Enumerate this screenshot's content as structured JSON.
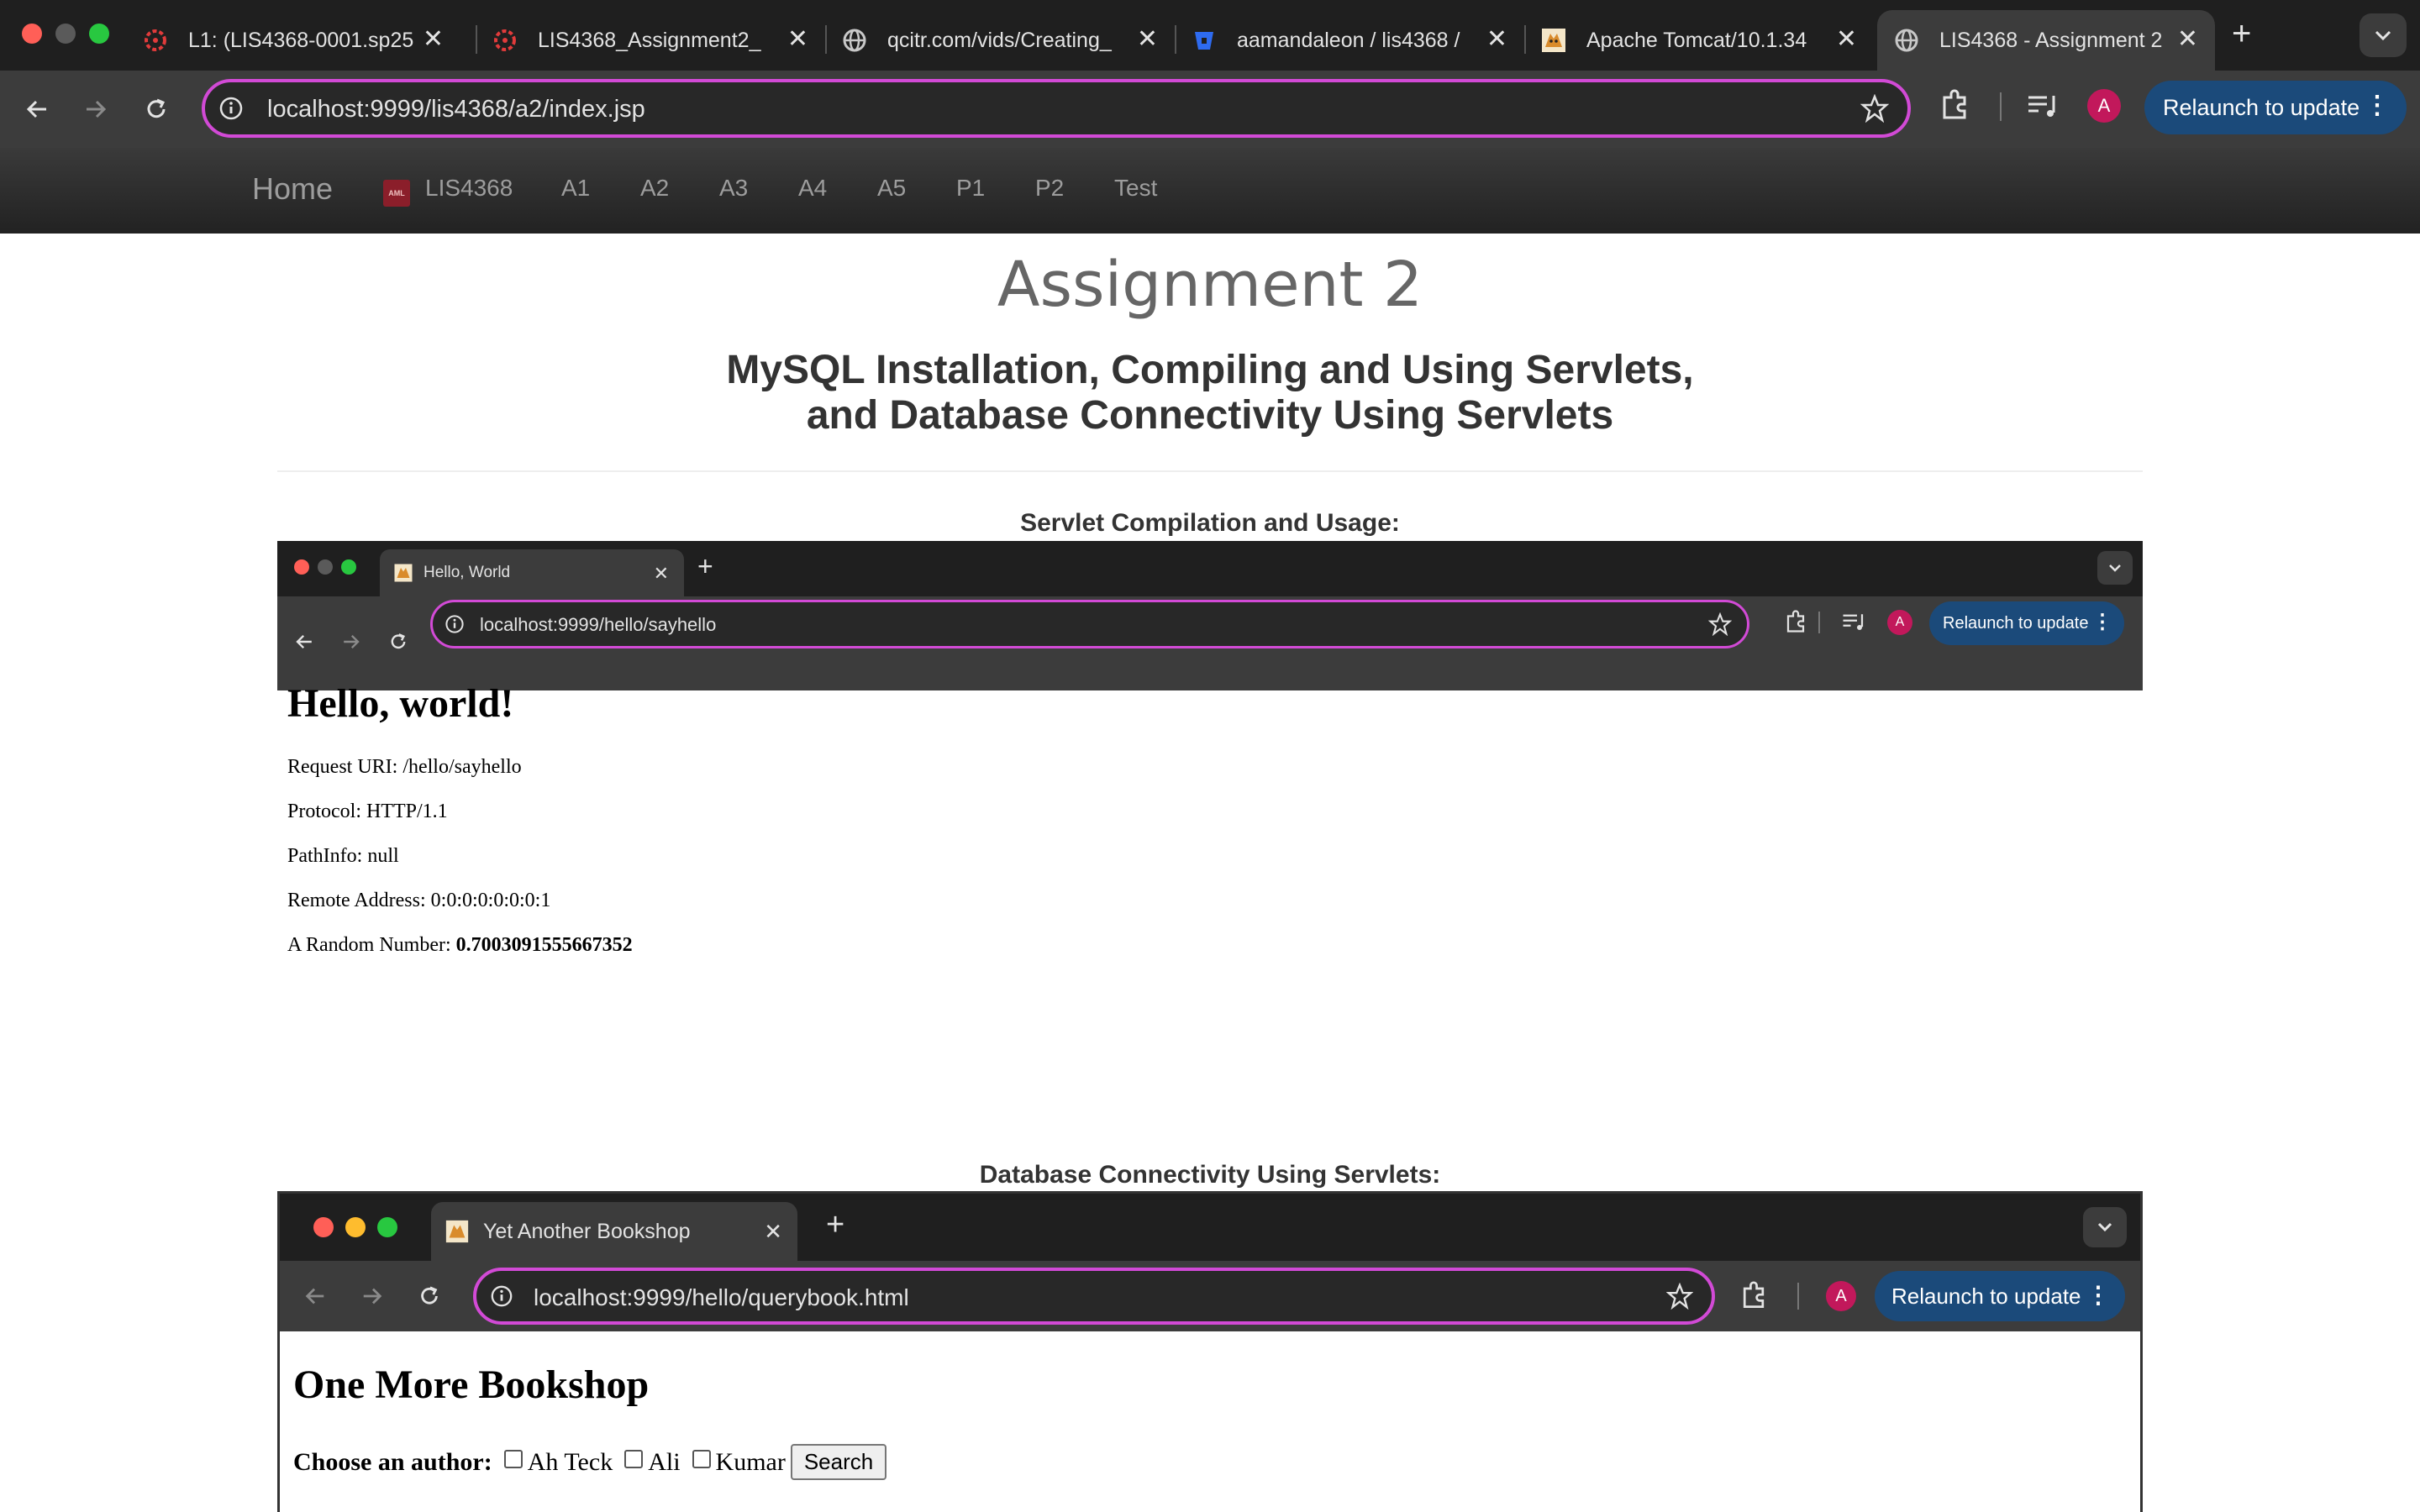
{
  "browser": {
    "tabs": [
      {
        "label": "L1: (LIS4368-0001.sp25",
        "icon": "canvas-icon"
      },
      {
        "label": "LIS4368_Assignment2_",
        "icon": "canvas-icon"
      },
      {
        "label": "qcitr.com/vids/Creating_",
        "icon": "globe-icon"
      },
      {
        "label": "aamandaleon / lis4368 /",
        "icon": "bitbucket-icon"
      },
      {
        "label": "Apache Tomcat/10.1.34",
        "icon": "tomcat-icon"
      },
      {
        "label": "LIS4368 - Assignment 2",
        "icon": "globe-icon"
      }
    ],
    "url": "localhost:9999/lis4368/a2/index.jsp",
    "relaunch_label": "Relaunch to update",
    "avatar_letter": "A"
  },
  "nav": {
    "home": "Home",
    "course": "LIS4368",
    "course_logo": "AML",
    "items": [
      "A1",
      "A2",
      "A3",
      "A4",
      "A5",
      "P1",
      "P2",
      "Test"
    ]
  },
  "page": {
    "title": "Assignment 2",
    "subtitle_line1": "MySQL Installation, Compiling and Using Servlets,",
    "subtitle_line2": "and Database Connectivity Using Servlets",
    "section1_heading": "Servlet Compilation and Usage:",
    "section2_heading": "Database Connectivity Using Servlets:"
  },
  "shot1": {
    "tab_label": "Hello, World",
    "url": "localhost:9999/hello/sayhello",
    "relaunch_label": "Relaunch to update",
    "avatar_letter": "A",
    "heading": "Hello, world!",
    "request_uri": "Request URI: /hello/sayhello",
    "protocol": "Protocol: HTTP/1.1",
    "pathinfo": "PathInfo: null",
    "remote_address": "Remote Address: 0:0:0:0:0:0:0:1",
    "random_label": "A Random Number: ",
    "random_value": "0.7003091555667352"
  },
  "shot2": {
    "tab_label": "Yet Another Bookshop",
    "url": "localhost:9999/hello/querybook.html",
    "relaunch_label": "Relaunch to update",
    "avatar_letter": "A",
    "heading": "One More Bookshop",
    "form_label": "Choose an author:",
    "authors": [
      "Ah Teck",
      "Ali",
      "Kumar"
    ],
    "search_label": "Search"
  },
  "colors": {
    "chrome_dark": "#1f1f1f",
    "chrome_toolbar": "#3c3c3c",
    "omnibox_focus": "#d24ad6",
    "relaunch_bg": "#1b4a7a",
    "navbar_text": "#9d9d9d"
  }
}
